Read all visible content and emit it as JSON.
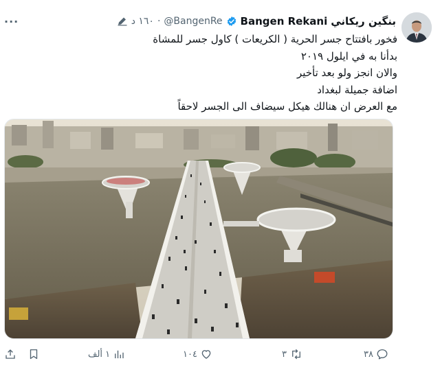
{
  "author": {
    "name_ar": "بنگين ريكاني",
    "name_en": "Bangen Rekani",
    "handle": "@BangenRe",
    "time": "١٦٠ د"
  },
  "tweet_lines": [
    "فخور بافتتاح جسر الحرية ( الكريعات ) كاول جسر للمشاة",
    "بدأنا به في ايلول ٢٠١٩",
    "والان انجز ولو بعد تأخير",
    "اضافة جميلة لبغداد",
    "مع العرض ان هنالك هيكل سيضاف الى الجسر لاحقاً"
  ],
  "actions": {
    "replies": "٣٨",
    "retweets": "٣",
    "likes": "١٠٤",
    "views": "١ ألف"
  },
  "icons": {
    "more": "more-horizontal-icon",
    "verified": "verified-badge-icon",
    "reply": "reply-icon",
    "retweet": "retweet-icon",
    "like": "heart-icon",
    "views": "views-icon",
    "bookmark": "bookmark-icon",
    "share": "share-icon"
  },
  "colors": {
    "verified": "#1d9bf0",
    "secondary_text": "#536471",
    "primary_text": "#0f1419"
  }
}
